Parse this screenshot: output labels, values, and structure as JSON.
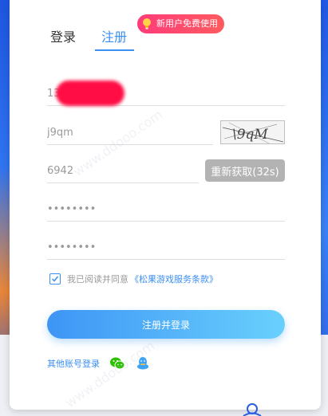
{
  "tabs": {
    "login": "登录",
    "register": "注册"
  },
  "promo": {
    "label": "新用户免费使用"
  },
  "form": {
    "phone_prefix": "13",
    "captcha_value": "j9qm",
    "captcha_image_text": "\\9qM",
    "sms_code_value": "6942",
    "sms_button_label": "重新获取(32s)",
    "password_value": "••••••••",
    "confirm_password_value": "••••••••"
  },
  "agreement": {
    "checked": true,
    "text": "我已阅读并同意",
    "link": "《松果游戏服务条款》"
  },
  "submit_label": "注册并登录",
  "other_login": {
    "label": "其他账号登录",
    "icons": [
      "wechat-icon",
      "qq-icon"
    ]
  },
  "watermark_text": "www.ddooo.com",
  "colors": {
    "accent": "#3b8ff0",
    "promo_red": "#ff3b7a",
    "sms_gray": "#b3b3b3",
    "wechat_green": "#2dc100",
    "qq_blue": "#3ea3f5"
  }
}
